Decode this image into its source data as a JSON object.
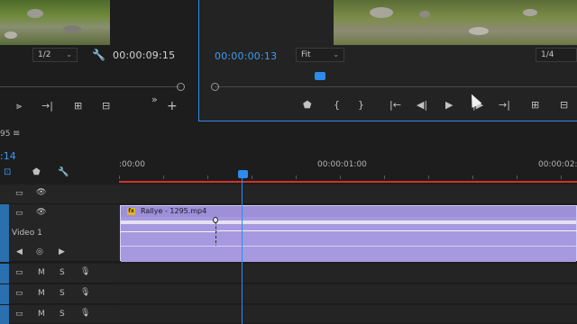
{
  "source_monitor": {
    "zoom": "1/2",
    "timecode": "00:00:09:15",
    "controls": [
      "mark-in-icon",
      "step-forward-icon",
      "insert-icon",
      "overwrite-icon",
      "more-icon",
      "add-icon"
    ]
  },
  "program_monitor": {
    "timecode": "00:00:00:13",
    "fit": "Fit",
    "resolution": "1/4",
    "controls": [
      "add-marker-icon",
      "mark-in-icon",
      "mark-out-icon",
      "go-to-in-icon",
      "step-back-icon",
      "play-icon",
      "step-forward-icon",
      "go-to-out-icon",
      "lift-icon",
      "extract-icon"
    ]
  },
  "timeline": {
    "sequence_name": "95",
    "timecode": ":14",
    "ruler_labels": [
      ":00:00",
      "00:00:01:00",
      "00:00:02:0"
    ],
    "tracks": {
      "video_track_label": "Video 1",
      "mute_label": "M",
      "solo_label": "S"
    },
    "clip": {
      "fx_badge": "fx",
      "title": "Rallye - 1295.mp4",
      "color": "#a699df"
    }
  },
  "colors": {
    "accent_blue": "#2d8ceb",
    "timecode_blue": "#3b9bf5",
    "work_area_red": "#d4322c"
  }
}
